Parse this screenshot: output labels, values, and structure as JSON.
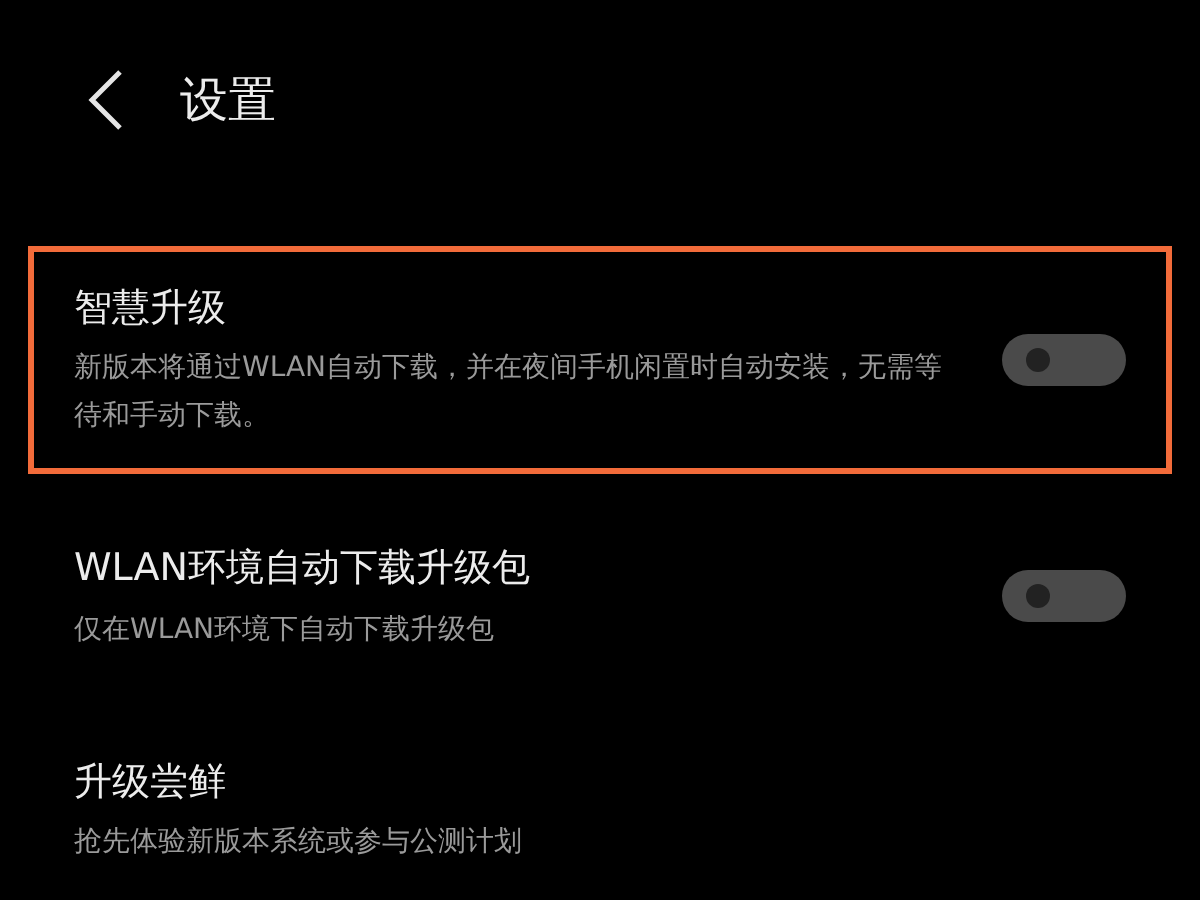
{
  "header": {
    "title": "设置"
  },
  "items": [
    {
      "kind": "switch",
      "title": "智慧升级",
      "description": "新版本将通过WLAN自动下载，并在夜间手机闲置时自动安装，无需等待和手动下载。",
      "on": false,
      "highlighted": true
    },
    {
      "kind": "switch",
      "title": "WLAN环境自动下载升级包",
      "description": "仅在WLAN环境下自动下载升级包",
      "on": false,
      "highlighted": false
    },
    {
      "kind": "link",
      "title": "升级尝鲜",
      "description": "抢先体验新版本系统或参与公测计划",
      "highlighted": false
    }
  ]
}
